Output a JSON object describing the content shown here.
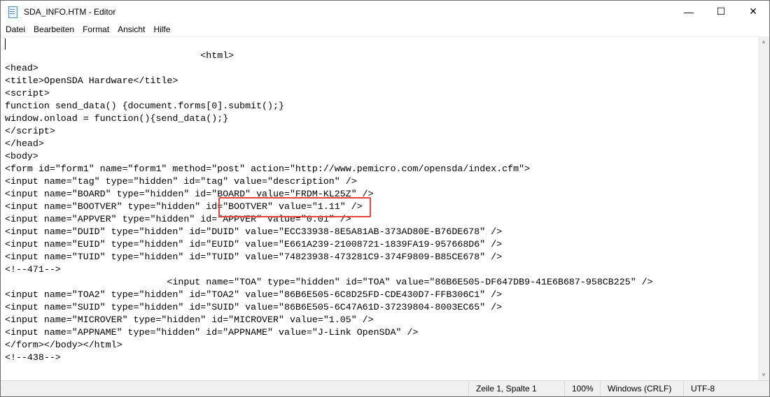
{
  "window": {
    "title": "SDA_INFO.HTM - Editor",
    "controls": {
      "minimize": "—",
      "maximize": "☐",
      "close": "✕"
    }
  },
  "menu": [
    "Datei",
    "Bearbeiten",
    "Format",
    "Ansicht",
    "Hilfe"
  ],
  "lines": [
    "",
    "                                   <html>",
    "<head>",
    "<title>OpenSDA Hardware</title>",
    "<script>",
    "function send_data() {document.forms[0].submit();}",
    "window.onload = function(){send_data();}",
    "</script>",
    "</head>",
    "<body>",
    "<form id=\"form1\" name=\"form1\" method=\"post\" action=\"http://www.pemicro.com/opensda/index.cfm\">",
    "<input name=\"tag\" type=\"hidden\" id=\"tag\" value=\"description\" />",
    "<input name=\"BOARD\" type=\"hidden\" id=\"BOARD\" value=\"FRDM-KL25Z\" />",
    "<input name=\"BOOTVER\" type=\"hidden\" id=\"BOOTVER\" value=\"1.11\" />",
    "<input name=\"APPVER\" type=\"hidden\" id=\"APPVER\" value=\"0.01\" />",
    "<input name=\"DUID\" type=\"hidden\" id=\"DUID\" value=\"ECC33938-8E5A81AB-373AD80E-B76DE678\" />",
    "<input name=\"EUID\" type=\"hidden\" id=\"EUID\" value=\"E661A239-21008721-1839FA19-957668D6\" />",
    "<input name=\"TUID\" type=\"hidden\" id=\"TUID\" value=\"74823938-473281C9-374F9809-B85CE678\" />",
    "<!--471-->",
    "                             <input name=\"TOA\" type=\"hidden\" id=\"TOA\" value=\"86B6E505-DF647DB9-41E6B687-958CB225\" />",
    "<input name=\"TOA2\" type=\"hidden\" id=\"TOA2\" value=\"86B6E505-6C8D25FD-CDE430D7-FFB306C1\" />",
    "<input name=\"SUID\" type=\"hidden\" id=\"SUID\" value=\"86B6E505-6C47A61D-37239804-8003EC65\" />",
    "<input name=\"MICROVER\" type=\"hidden\" id=\"MICROVER\" value=\"1.05\" />",
    "<input name=\"APPNAME\" type=\"hidden\" id=\"APPNAME\" value=\"J-Link OpenSDA\" />",
    "</form></body></html>",
    "<!--438-->"
  ],
  "status": {
    "position": "Zeile 1, Spalte 1",
    "zoom": "100%",
    "line_ending": "Windows (CRLF)",
    "encoding": "UTF-8"
  },
  "colors": {
    "highlight": "#e8413c"
  }
}
